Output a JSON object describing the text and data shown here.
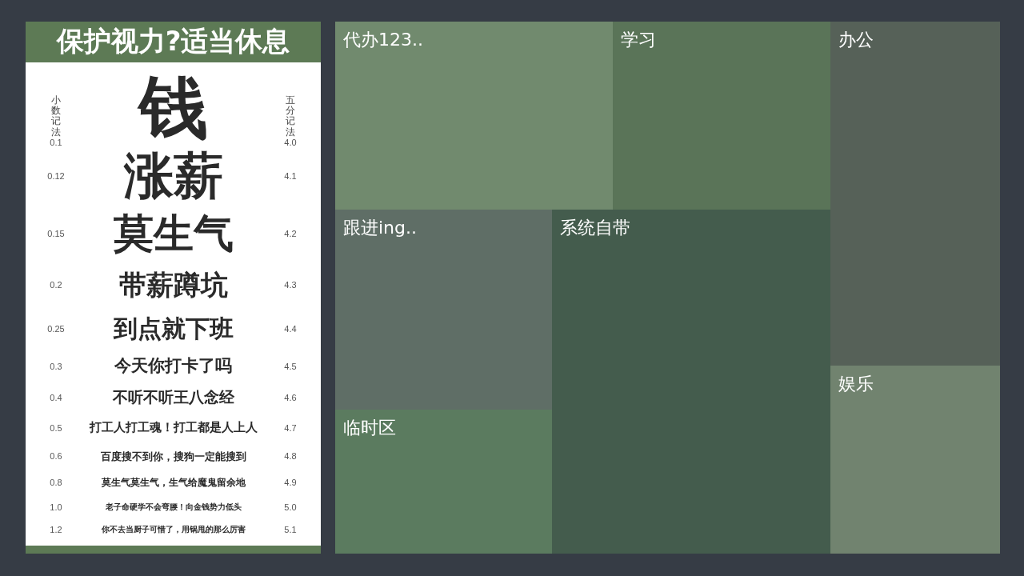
{
  "eye_chart": {
    "title": "保护视力?适当休息",
    "left_header": "小数记法",
    "right_header": "五分记法",
    "rows": [
      {
        "decimal": "0.1",
        "text": "钱",
        "five": "4.0"
      },
      {
        "decimal": "0.12",
        "text": "涨薪",
        "five": "4.1"
      },
      {
        "decimal": "0.15",
        "text": "莫生气",
        "five": "4.2"
      },
      {
        "decimal": "0.2",
        "text": "带薪蹲坑",
        "five": "4.3"
      },
      {
        "decimal": "0.25",
        "text": "到点就下班",
        "five": "4.4"
      },
      {
        "decimal": "0.3",
        "text": "今天你打卡了吗",
        "five": "4.5"
      },
      {
        "decimal": "0.4",
        "text": "不听不听王八念经",
        "five": "4.6"
      },
      {
        "decimal": "0.5",
        "text": "打工人打工魂！打工都是人上人",
        "five": "4.7"
      },
      {
        "decimal": "0.6",
        "text": "百度搜不到你，搜狗一定能搜到",
        "five": "4.8"
      },
      {
        "decimal": "0.8",
        "text": "莫生气莫生气，生气给魔鬼留余地",
        "five": "4.9"
      },
      {
        "decimal": "1.0",
        "text": "老子命硬学不会弯腰！向金钱势力低头",
        "five": "5.0"
      },
      {
        "decimal": "1.2",
        "text": "你不去当厨子可惜了，用锅甩的那么厉害",
        "five": "5.1"
      }
    ]
  },
  "zones": [
    {
      "label": "代办123..",
      "color": "#718a6e"
    },
    {
      "label": "学习",
      "color": "#5a7458"
    },
    {
      "label": "办公",
      "color": "#566158"
    },
    {
      "label": "跟进ing..",
      "color": "#5f6e66"
    },
    {
      "label": "系统自带",
      "color": "#445c4d"
    },
    {
      "label": "临时区",
      "color": "#5b7b5f"
    },
    {
      "label": "娱乐",
      "color": "#71836f"
    }
  ]
}
